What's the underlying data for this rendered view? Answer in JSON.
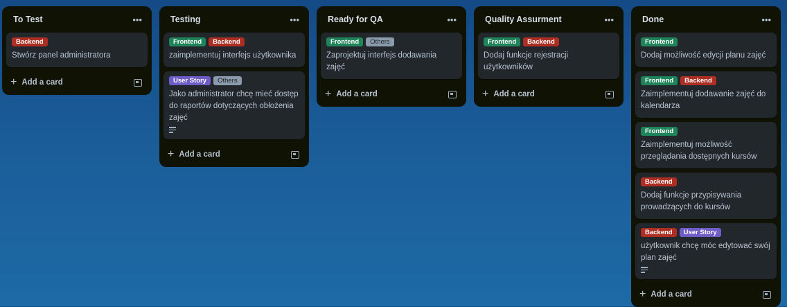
{
  "board": {
    "lists": [
      {
        "title": "To Test",
        "add_label": "Add a card",
        "cards": [
          {
            "labels": [
              {
                "text": "Backend",
                "kind": "backend"
              }
            ],
            "title": "Stwórz panel administratora"
          }
        ]
      },
      {
        "title": "Testing",
        "add_label": "Add a card",
        "cards": [
          {
            "labels": [
              {
                "text": "Frontend",
                "kind": "frontend"
              },
              {
                "text": "Backend",
                "kind": "backend"
              }
            ],
            "title": "zaimplementuj interfejs użytkownika"
          },
          {
            "labels": [
              {
                "text": "User Story",
                "kind": "userstory"
              },
              {
                "text": "Others",
                "kind": "others"
              }
            ],
            "title": "Jako administrator chcę mieć dostęp do raportów dotyczących obłożenia zajęć",
            "has_description": true
          }
        ]
      },
      {
        "title": "Ready for QA",
        "add_label": "Add a card",
        "cards": [
          {
            "labels": [
              {
                "text": "Frontend",
                "kind": "frontend"
              },
              {
                "text": "Others",
                "kind": "others"
              }
            ],
            "title": "Zaprojektuj interfejs dodawania zajęć"
          }
        ]
      },
      {
        "title": "Quality Assurment",
        "add_label": "Add a card",
        "cards": [
          {
            "labels": [
              {
                "text": "Frontend",
                "kind": "frontend"
              },
              {
                "text": "Backend",
                "kind": "backend"
              }
            ],
            "title": "Dodaj funkcje rejestracji użytkowników"
          }
        ]
      },
      {
        "title": "Done",
        "add_label": "Add a card",
        "cards": [
          {
            "labels": [
              {
                "text": "Frontend",
                "kind": "frontend"
              }
            ],
            "title": "Dodaj możliwość edycji planu zajęć"
          },
          {
            "labels": [
              {
                "text": "Frontend",
                "kind": "frontend"
              },
              {
                "text": "Backend",
                "kind": "backend"
              }
            ],
            "title": "Zaimplementuj dodawanie zajęć do kalendarza"
          },
          {
            "labels": [
              {
                "text": "Frontend",
                "kind": "frontend"
              }
            ],
            "title": "Zaimplementuj możliwość przeglądania dostępnych kursów"
          },
          {
            "labels": [
              {
                "text": "Backend",
                "kind": "backend"
              }
            ],
            "title": "Dodaj funkcje przypisywania prowadzących do kursów"
          },
          {
            "labels": [
              {
                "text": "Backend",
                "kind": "backend"
              },
              {
                "text": "User Story",
                "kind": "userstory"
              }
            ],
            "title": "użytkownik chcę móc edytować swój plan zajęć",
            "has_description": true
          }
        ]
      }
    ]
  },
  "icons": {
    "menu": "more-dots-icon",
    "add": "plus-icon",
    "template": "card-template-icon",
    "description": "description-icon"
  },
  "colors": {
    "list_bg": "#101204",
    "card_bg": "#22272b",
    "frontend": "#1f845a",
    "backend": "#ae2e24",
    "userstory": "#6e5dc6",
    "others": "#8c9bab"
  }
}
